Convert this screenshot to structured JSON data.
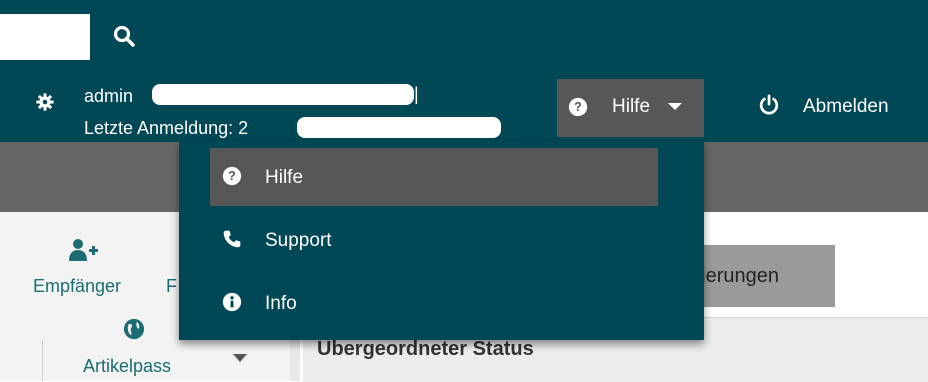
{
  "header": {
    "user_prefix": "admin",
    "user_suffix": "|",
    "last_login_prefix": "Letzte Anmeldung: 2",
    "help_label": "Hilfe",
    "logout_label": "Abmelden"
  },
  "dropdown": {
    "items": [
      {
        "label": "Hilfe",
        "icon": "question-circle-icon"
      },
      {
        "label": "Support",
        "icon": "phone-icon"
      },
      {
        "label": "Info",
        "icon": "info-circle-icon"
      }
    ]
  },
  "sidebar": {
    "empfaenger_label": "Empfänger",
    "f_partial": "F",
    "artikelpass_label": "Artikelpass"
  },
  "main": {
    "tab_label": "dierungen",
    "section_title": "Übergeordneter Status"
  },
  "colors": {
    "header_bg": "#004855",
    "active_item_bg": "#575757",
    "gray_band": "#666666",
    "nav_text": "#1b6d73"
  }
}
